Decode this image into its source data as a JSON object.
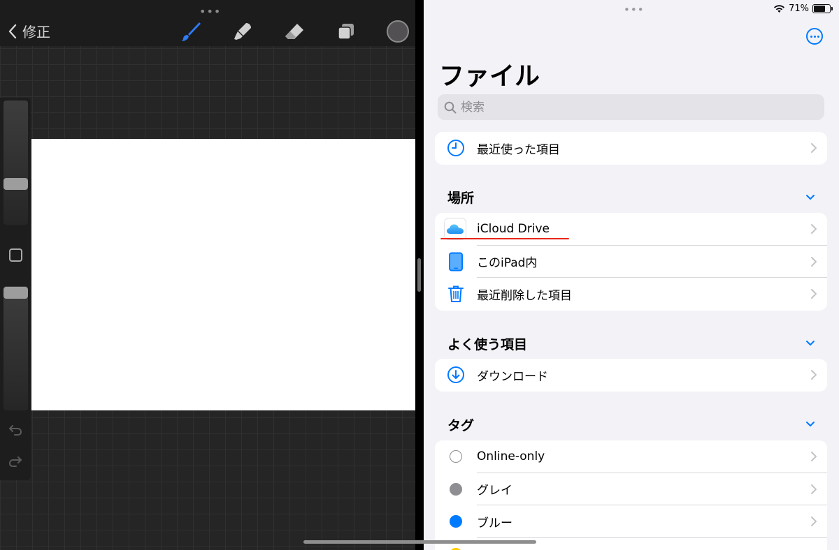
{
  "procreate": {
    "back_label": "修正",
    "tools": {
      "brush": "brush-icon",
      "smudge": "smudge-icon",
      "eraser": "eraser-icon",
      "layers": "layers-icon"
    },
    "active_tool_color": "#2f7bf5",
    "current_color": "#525052",
    "brush_size_level": 0.35,
    "opacity_level": 0.95
  },
  "files": {
    "status": {
      "battery": "71%",
      "battery_level": 0.71
    },
    "title": "ファイル",
    "search_placeholder": "検索",
    "recents_label": "最近使った項目",
    "locations": {
      "header": "場所",
      "items": [
        {
          "label": "iCloud Drive",
          "icon": "icloud-icon"
        },
        {
          "label": "このiPad内",
          "icon": "ipad-icon"
        },
        {
          "label": "最近削除した項目",
          "icon": "trash-icon"
        }
      ]
    },
    "favorites": {
      "header": "よく使う項目",
      "items": [
        {
          "label": "ダウンロード",
          "icon": "download-icon"
        }
      ]
    },
    "tags": {
      "header": "タグ",
      "items": [
        {
          "label": "Online-only",
          "color": "#ffffff"
        },
        {
          "label": "グレイ",
          "color": "#8e8e93"
        },
        {
          "label": "ブルー",
          "color": "#007aff"
        }
      ]
    },
    "accent_color": "#007aff",
    "highlight_color": "#e8281a"
  }
}
